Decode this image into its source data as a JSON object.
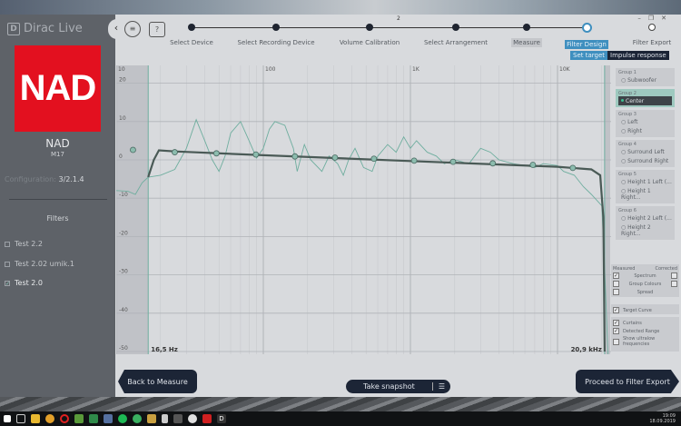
{
  "app": {
    "name": "Dirac Live",
    "counter": "2",
    "window_controls": [
      "–",
      "❐",
      "✕"
    ]
  },
  "sidebar": {
    "brand_logo": "NAD",
    "brand": "NAD",
    "model": "M17",
    "config_label": "Configuration:",
    "config_value": "3/2.1.4",
    "filters_title": "Filters",
    "filters": [
      {
        "label": "Test 2.2",
        "checked": false
      },
      {
        "label": "Test 2.02 umik.1",
        "checked": false
      },
      {
        "label": "Test 2.0",
        "checked": true
      }
    ]
  },
  "toolbar": {
    "collapse": "‹",
    "menu": "≡",
    "help": "?"
  },
  "steps": [
    {
      "label": "Select Device"
    },
    {
      "label": "Select Recording Device"
    },
    {
      "label": "Volume Calibration"
    },
    {
      "label": "Select Arrangement"
    },
    {
      "label": "Measure"
    },
    {
      "label": "Filter Design"
    },
    {
      "label": "Filter Export"
    }
  ],
  "subtabs": {
    "set_target": "Set target",
    "impulse": "Impulse response"
  },
  "groups": [
    {
      "title": "Group 1",
      "channels": [
        "Subwoofer"
      ]
    },
    {
      "title": "Group 2",
      "channels": [
        "Center"
      ]
    },
    {
      "title": "Group 3",
      "channels": [
        "Left",
        "Right"
      ]
    },
    {
      "title": "Group 4",
      "channels": [
        "Surround Left",
        "Surround Right"
      ]
    },
    {
      "title": "Group 5",
      "channels": [
        "Height 1 Left (...",
        "Height 1 Right..."
      ]
    },
    {
      "title": "Group 6",
      "channels": [
        "Height 2 Left (...",
        "Height 2 Right..."
      ]
    }
  ],
  "display_options": {
    "measured": "Measured",
    "corrected": "Corrected",
    "spectrum": "Spectrum",
    "group_colours": "Group Colours",
    "spread": "Spread",
    "target_curve": "Target Curve",
    "curtains": "Curtains",
    "detected_range": "Detected Range",
    "ultralow": "Show ultralow frequencies"
  },
  "buttons": {
    "back": "Back to Measure",
    "snapshot": "Take snapshot",
    "snapshot_icon": "☰",
    "proceed": "Proceed to Filter Export"
  },
  "taskbar": {
    "time": "19:09",
    "date": "18.09.2019"
  },
  "colors": {
    "accent": "#3f8fbf",
    "nad_red": "#e3101f",
    "measured": "#6fae9f",
    "target": "#4a5a56"
  },
  "chart_data": {
    "type": "line",
    "xscale": "log",
    "xlim": [
      10,
      24000
    ],
    "ylim": [
      -50,
      20
    ],
    "x_ticks": [
      "10",
      "100",
      "1K",
      "10K"
    ],
    "y_ticks": [
      "20",
      "10",
      "0",
      "-10",
      "-20",
      "-30",
      "-40",
      "-50"
    ],
    "curtain_low_label": "16,5 Hz",
    "curtain_high_label": "20,9 kHz",
    "curtain_low": 16.5,
    "curtain_high": 20900,
    "series": [
      {
        "name": "Measured",
        "points": [
          [
            10,
            -8
          ],
          [
            12,
            -8.2
          ],
          [
            13.5,
            -9
          ],
          [
            15,
            -6
          ],
          [
            16.5,
            -4.5
          ],
          [
            20,
            -4
          ],
          [
            25,
            -2.5
          ],
          [
            30,
            3
          ],
          [
            35,
            10.5
          ],
          [
            40,
            5
          ],
          [
            45,
            0
          ],
          [
            50,
            -3
          ],
          [
            55,
            1
          ],
          [
            60,
            7
          ],
          [
            70,
            10
          ],
          [
            80,
            5
          ],
          [
            90,
            0.5
          ],
          [
            100,
            3
          ],
          [
            110,
            8
          ],
          [
            120,
            10
          ],
          [
            140,
            9
          ],
          [
            160,
            3
          ],
          [
            170,
            -3
          ],
          [
            190,
            4
          ],
          [
            210,
            0
          ],
          [
            250,
            -3
          ],
          [
            280,
            1
          ],
          [
            320,
            -1
          ],
          [
            350,
            -4
          ],
          [
            380,
            0
          ],
          [
            420,
            3
          ],
          [
            480,
            -2
          ],
          [
            550,
            -3
          ],
          [
            600,
            1
          ],
          [
            700,
            4
          ],
          [
            800,
            2
          ],
          [
            900,
            6
          ],
          [
            1000,
            3
          ],
          [
            1100,
            5
          ],
          [
            1300,
            2
          ],
          [
            1500,
            1
          ],
          [
            1700,
            -1
          ],
          [
            2000,
            0
          ],
          [
            2500,
            -1
          ],
          [
            3000,
            3
          ],
          [
            3500,
            2
          ],
          [
            4000,
            0
          ],
          [
            5000,
            -1
          ],
          [
            6000,
            -1.5
          ],
          [
            7000,
            -2
          ],
          [
            8000,
            -1
          ],
          [
            10000,
            -1.5
          ],
          [
            11000,
            -3
          ],
          [
            13000,
            -4
          ],
          [
            15000,
            -7
          ],
          [
            17000,
            -9
          ],
          [
            20000,
            -12
          ],
          [
            21000,
            -30
          ],
          [
            22000,
            -60
          ]
        ]
      },
      {
        "name": "Target",
        "points": [
          [
            16.5,
            -4.5
          ],
          [
            18,
            0
          ],
          [
            19.5,
            2.5
          ],
          [
            25,
            2.2
          ],
          [
            100,
            1.2
          ],
          [
            1000,
            -0.3
          ],
          [
            10000,
            -1.8
          ],
          [
            17000,
            -2.5
          ],
          [
            19500,
            -4
          ],
          [
            20500,
            -15
          ],
          [
            20900,
            -50
          ]
        ]
      }
    ],
    "control_points": [
      [
        13,
        2.6
      ],
      [
        25,
        2.0
      ],
      [
        48,
        1.7
      ],
      [
        89,
        1.4
      ],
      [
        164,
        0.9
      ],
      [
        307,
        0.6
      ],
      [
        565,
        0.3
      ],
      [
        1060,
        -0.2
      ],
      [
        1950,
        -0.5
      ],
      [
        3630,
        -0.9
      ],
      [
        6800,
        -1.3
      ],
      [
        12700,
        -2.1
      ]
    ]
  }
}
